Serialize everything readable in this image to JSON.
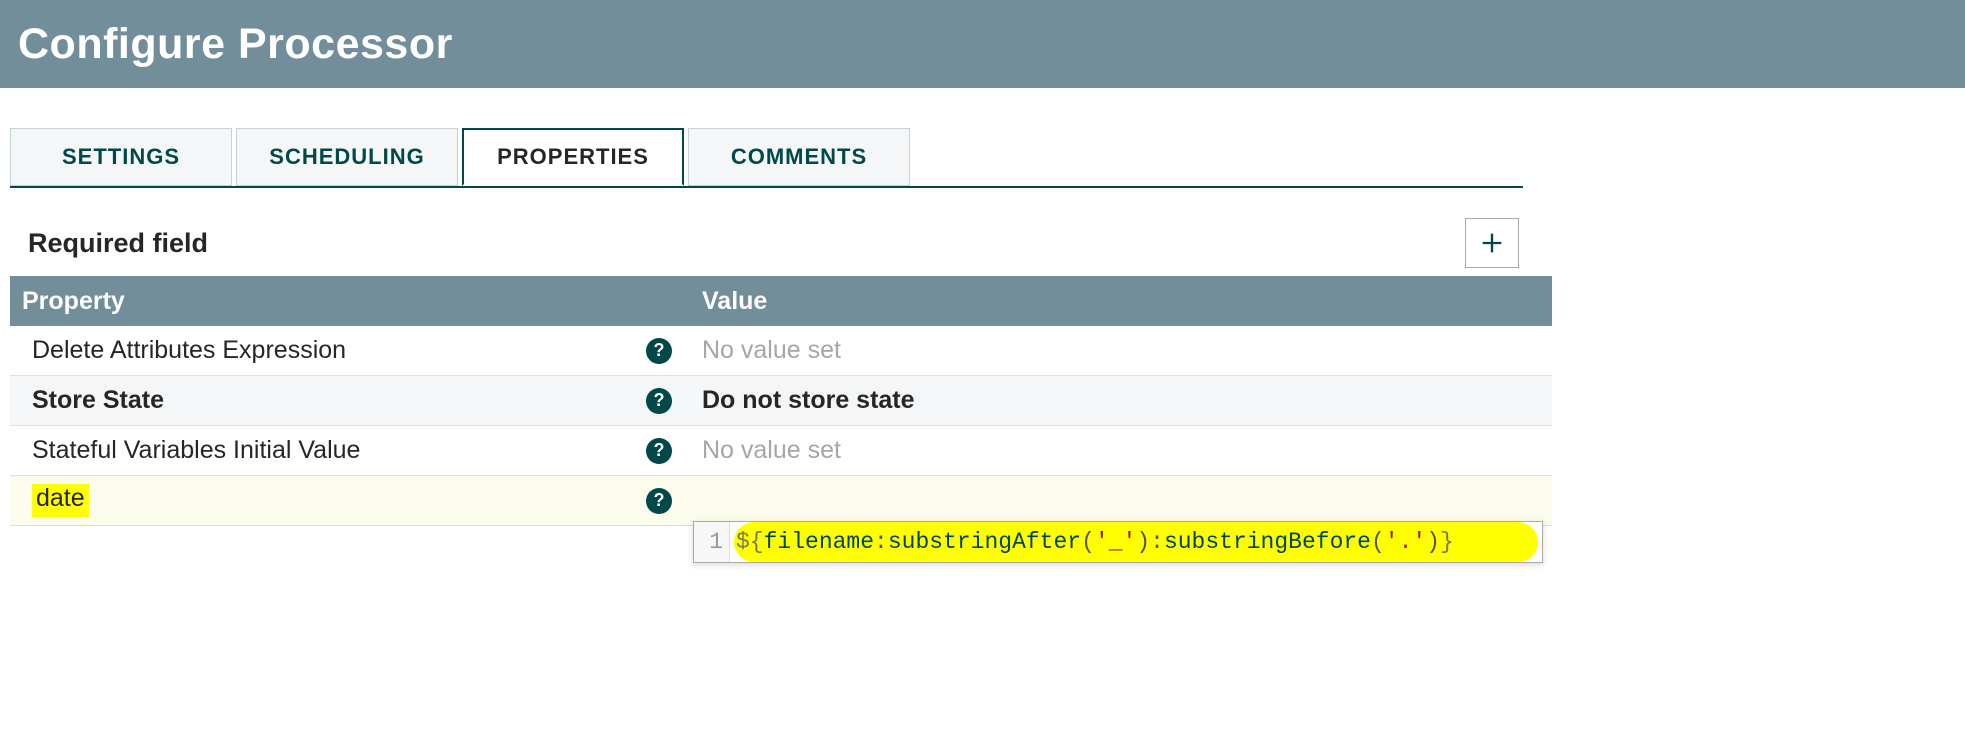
{
  "header": {
    "title": "Configure Processor"
  },
  "tabs": {
    "items": [
      {
        "label": "SETTINGS"
      },
      {
        "label": "SCHEDULING"
      },
      {
        "label": "PROPERTIES"
      },
      {
        "label": "COMMENTS"
      }
    ],
    "activeIndex": 2
  },
  "required_label": "Required field",
  "columns": {
    "property": "Property",
    "value": "Value"
  },
  "rows": [
    {
      "name": "Delete Attributes Expression",
      "bold": false,
      "value": "No value set",
      "valueStyle": "placeholder",
      "highlight": false
    },
    {
      "name": "Store State",
      "bold": true,
      "value": "Do not store state",
      "valueStyle": "bold",
      "highlight": false
    },
    {
      "name": "Stateful Variables Initial Value",
      "bold": false,
      "value": "No value set",
      "valueStyle": "placeholder",
      "highlight": false
    },
    {
      "name": "date",
      "bold": false,
      "value": "",
      "valueStyle": "editing",
      "highlight": true
    }
  ],
  "editor": {
    "line_number": "1",
    "tokens": {
      "open": "${",
      "ident": "filename",
      "colon1": ":",
      "fn1": "substringAfter",
      "p1o": "(",
      "arg1": "'_'",
      "p1c": ")",
      "colon2": ":",
      "fn2": "substringBefore",
      "p2o": "(",
      "arg2": "'.'",
      "p2c": ")",
      "close": "}"
    }
  }
}
